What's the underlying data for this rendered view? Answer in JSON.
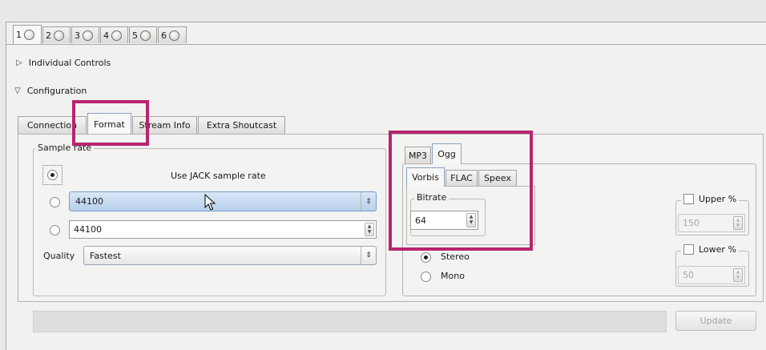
{
  "top_tabs": [
    "1",
    "2",
    "3",
    "4",
    "5",
    "6"
  ],
  "expanders": {
    "individual_controls": "Individual Controls",
    "configuration": "Configuration"
  },
  "sub_tabs": [
    "Connection",
    "Format",
    "Stream Info",
    "Extra Shoutcast"
  ],
  "sample_rate": {
    "legend": "Sample rate",
    "option_jack": "Use JACK sample rate",
    "combo_value": "44100",
    "spin_value": "44100",
    "quality_label": "Quality",
    "quality_value": "Fastest"
  },
  "codec_tabs": [
    "MP3",
    "Ogg"
  ],
  "ogg_tabs": [
    "Vorbis",
    "FLAC",
    "Speex"
  ],
  "bitrate": {
    "legend": "Bitrate",
    "value": "64"
  },
  "upper": {
    "label": "Upper %",
    "value": "150"
  },
  "lower": {
    "label": "Lower %",
    "value": "50"
  },
  "channels": {
    "stereo": "Stereo",
    "mono": "Mono"
  },
  "update_button": "Update",
  "colors": {
    "annotation": "#b8246e",
    "selection": "#b8d0ec"
  }
}
